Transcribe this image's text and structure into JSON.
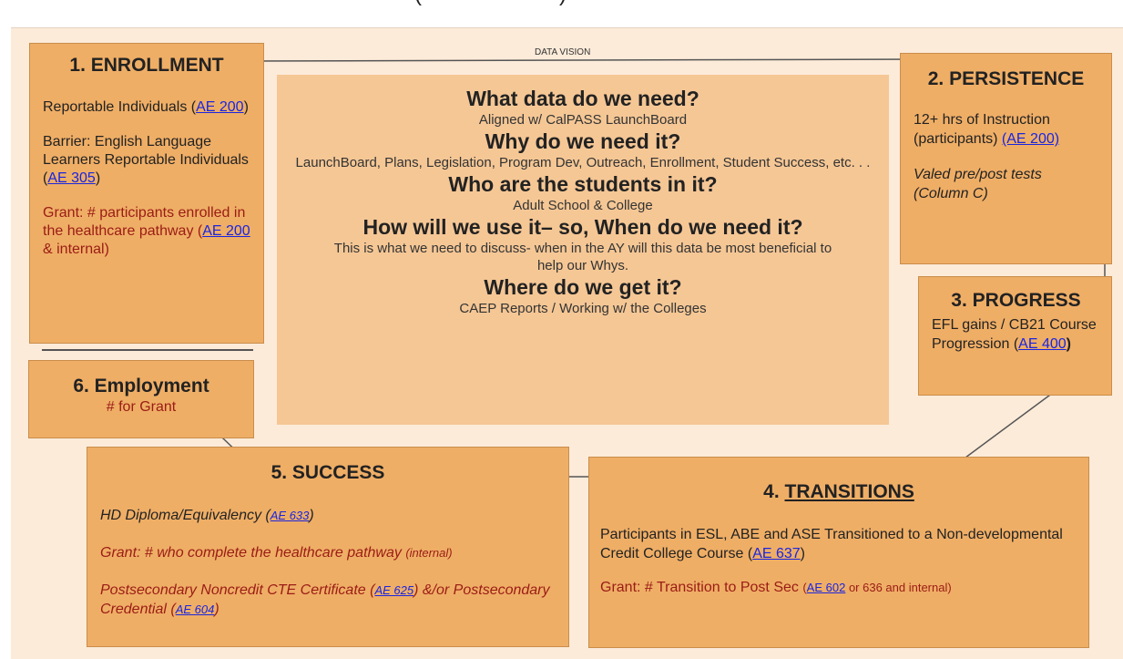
{
  "top_clip": "(",
  "top_clip_right": ")",
  "vision_label": "DATA VISION",
  "enrollment": {
    "title": "1. ENROLLMENT",
    "item1_text": "Reportable Individuals (",
    "item1_link": "AE 200",
    "item1_end": ")",
    "item2_text": "Barrier: English Language Learners Reportable Individuals (",
    "item2_link": "AE 305",
    "item2_end": ")",
    "grant_text": "Grant: # participants enrolled in the healthcare pathway (",
    "grant_link": "AE 200",
    "grant_end": " & internal)"
  },
  "persistence": {
    "title": "2. PERSISTENCE",
    "item1_text": "12+ hrs of Instruction (participants) ",
    "item1_link": "(AE 200)",
    "item2_text": "Valed pre/post tests (Column C)"
  },
  "progress": {
    "title": "3. PROGRESS",
    "item1_text": "EFL gains / CB21 Course Progression (",
    "item1_link": "AE 400",
    "item1_end": ")"
  },
  "employment": {
    "title": "6. Employment",
    "sub": "# for Grant"
  },
  "center": {
    "q1": "What data do we need?",
    "a1": "Aligned w/ CalPASS LaunchBoard",
    "q2": "Why do we need it?",
    "a2": "LaunchBoard, Plans, Legislation, Program Dev, Outreach, Enrollment, Student Success, etc. . .",
    "q3": "Who are the students in it?",
    "a3": "Adult School & College",
    "q4": "How will we use it– so, When do we need it?",
    "a4": "This is what we need to discuss- when in the AY will this data be most beneficial to help our Whys.",
    "q5": "Where do we get it?",
    "a5": "CAEP Reports / Working w/ the Colleges"
  },
  "success": {
    "title": "5. SUCCESS",
    "item1_text": "HD Diploma/Equivalency (",
    "item1_link": "AE 633",
    "item1_end": ")",
    "item2_text": "Grant: # who complete the healthcare pathway ",
    "item2_small": "(internal)",
    "item3_text": "Postsecondary Noncredit CTE Certificate (",
    "item3_link": "AE 625",
    "item3_mid": ") &/or Postsecondary Credential (",
    "item3_link2": "AE 604",
    "item3_end": ")"
  },
  "transitions": {
    "title_num": "4. ",
    "title_word": "TRANSITIONS",
    "item1_text": "Participants in ESL, ABE and ASE Transitioned to a Non-developmental Credit College Course (",
    "item1_link": "AE 637",
    "item1_end": ")",
    "grant_text": "Grant: # Transition to Post Sec ",
    "grant_small1": "(",
    "grant_link": "AE 602",
    "grant_small2": " or 636  and internal)"
  },
  "colors": {
    "canvas": "#fcebd9",
    "box": "#efae66",
    "center": "#f5c795",
    "grant_red": "#9a1c15",
    "link_blue": "#1a25e0"
  }
}
